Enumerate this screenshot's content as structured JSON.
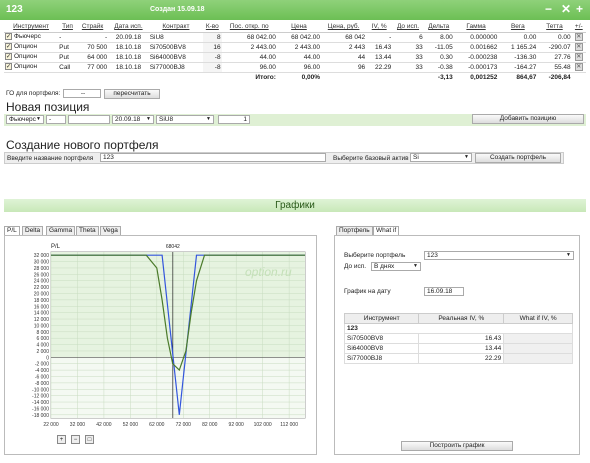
{
  "header": {
    "title": "123",
    "created": "Создан 15.09.18"
  },
  "table": {
    "columns": [
      "Инструмент",
      "Тип",
      "Страйк",
      "Дата исп.",
      "Контракт",
      "К-во",
      "Пос. откр. по",
      "Цена",
      "Цена, руб.",
      "IV, %",
      "До исп.",
      "Дельта",
      "Гамма",
      "Вега",
      "Тетта",
      "+/-"
    ],
    "rows": [
      {
        "instrument": "Фьючерс",
        "type": "-",
        "strike": "-",
        "date": "20.09.18",
        "contract": "SiU8",
        "qty": "8",
        "open": "68 042.00",
        "price": "68 042.00",
        "price_rub": "68 042",
        "iv": "-",
        "days": "6",
        "delta": "8.00",
        "gamma": "0.000000",
        "vega": "0.00",
        "theta": "0.00"
      },
      {
        "instrument": "Опцион",
        "type": "Put",
        "strike": "70 500",
        "date": "18.10.18",
        "contract": "Si70500BV8",
        "qty": "16",
        "open": "2 443.00",
        "price": "2 443.00",
        "price_rub": "2 443",
        "iv": "16.43",
        "days": "33",
        "delta": "-11.05",
        "gamma": "0.001662",
        "vega": "1 165.24",
        "theta": "-290.07"
      },
      {
        "instrument": "Опцион",
        "type": "Put",
        "strike": "64 000",
        "date": "18.10.18",
        "contract": "Si64000BV8",
        "qty": "-8",
        "open": "44.00",
        "price": "44.00",
        "price_rub": "44",
        "iv": "13.44",
        "days": "33",
        "delta": "0.30",
        "gamma": "-0.000238",
        "vega": "-136.30",
        "theta": "27.76"
      },
      {
        "instrument": "Опцион",
        "type": "Call",
        "strike": "77 000",
        "date": "18.10.18",
        "contract": "Si77000BJ8",
        "qty": "-8",
        "open": "96.00",
        "price": "96.00",
        "price_rub": "96",
        "iv": "22.29",
        "days": "33",
        "delta": "-0.38",
        "gamma": "-0.000173",
        "vega": "-164.27",
        "theta": "55.48"
      }
    ],
    "totals": {
      "label": "Итого:",
      "open": "0,00%",
      "delta": "-3,13",
      "gamma": "0,001252",
      "vega": "864,67",
      "theta": "-206,84"
    }
  },
  "go": {
    "label": "ГО для портфеля:",
    "value": "--",
    "recalc": "пересчитать"
  },
  "new_position": {
    "title": "Новая позиция",
    "instrument": "Фьючерс",
    "type": "-",
    "strike": "",
    "date": "20.09.18",
    "contract": "SiU8",
    "qty": "1",
    "add_button": "Добавить позицию"
  },
  "new_portfolio": {
    "title": "Создание нового портфеля",
    "name_label": "Введите название портфеля",
    "name_value": "123",
    "asset_label": "Выберите базовый актив",
    "asset_value": "Si",
    "create_button": "Создать портфель"
  },
  "graphs": {
    "title": "Графики",
    "tabs": [
      "P/L",
      "Delta",
      "Gamma",
      "Theta",
      "Vega"
    ],
    "watermark": "option.ru",
    "marker_label": "68042",
    "y_axis_title": "P/L"
  },
  "chart_data": {
    "type": "line",
    "ylabel": "P/L",
    "xlim": [
      22000,
      118000
    ],
    "ylim": [
      -19000,
      33000
    ],
    "x_ticks": [
      "22 000",
      "32 000",
      "42 000",
      "52 000",
      "62 000",
      "72 000",
      "82 000",
      "92 000",
      "102 000",
      "112 000"
    ],
    "y_ticks": [
      "32 000",
      "30 000",
      "28 000",
      "26 000",
      "24 000",
      "22 000",
      "20 000",
      "18 000",
      "16 000",
      "14 000",
      "12 000",
      "10 000",
      "8 000",
      "6 000",
      "4 000",
      "2 000",
      "0",
      "-2 000",
      "-4 000",
      "-6 000",
      "-8 000",
      "-10 000",
      "-12 000",
      "-14 000",
      "-16 000",
      "-18 000"
    ],
    "marker_x": 68042,
    "series": [
      {
        "color": "#3355dd",
        "x": [
          22000,
          60000,
          64000,
          70500,
          77000,
          81000,
          118000
        ],
        "y": [
          32000,
          32000,
          32000,
          -18000,
          32000,
          32000,
          32000
        ]
      },
      {
        "color": "#4a7a2a",
        "x": [
          22000,
          58000,
          62000,
          64000,
          66000,
          68000,
          70500,
          73000,
          75000,
          77000,
          80000,
          118000
        ],
        "y": [
          32000,
          32000,
          28000,
          18000,
          6000,
          -2000,
          -4000,
          2000,
          14000,
          24000,
          32000,
          32000
        ]
      }
    ]
  },
  "right_panel": {
    "tabs": [
      "Портфель",
      "What if"
    ],
    "portfolio_label": "Выберите портфель",
    "portfolio_value": "123",
    "date_label": "До исп.",
    "date_value": "В днях",
    "graph_date_label": "График на дату",
    "graph_date_value": "16.09.18",
    "table_headers": [
      "Инструмент",
      "Реальная IV, %",
      "What if IV, %"
    ],
    "group": "123",
    "rows": [
      {
        "name": "Si70500BV8",
        "iv": "16.43"
      },
      {
        "name": "Si64000BV8",
        "iv": "13.44"
      },
      {
        "name": "Si77000BJ8",
        "iv": "22.29"
      }
    ],
    "build_button": "Построить график"
  },
  "icons": {
    "minimize": "minus-icon",
    "close": "close-icon",
    "add": "plus-icon",
    "zoom_in": "zoom-in-icon",
    "zoom_out": "zoom-out-icon",
    "zoom_reset": "zoom-reset-icon"
  }
}
